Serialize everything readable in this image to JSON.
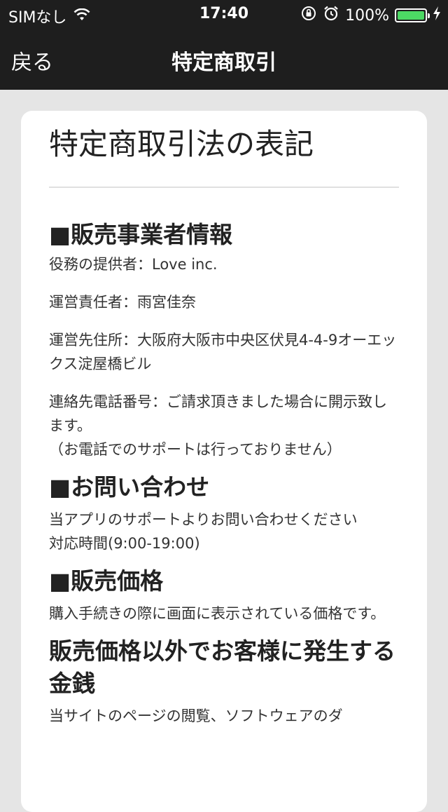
{
  "status_bar": {
    "carrier": "SIMなし",
    "time": "17:40",
    "battery_percent": "100%",
    "icons": [
      "wifi-icon",
      "orientation-lock-icon",
      "alarm-icon",
      "battery-icon",
      "charging-icon"
    ]
  },
  "nav": {
    "back_label": "戻る",
    "title": "特定商取引"
  },
  "page": {
    "title": "特定商取引法の表記",
    "sections": [
      {
        "heading": "■販売事業者情報",
        "paragraphs": [
          "役務の提供者：Love inc.",
          "運営責任者：雨宮佳奈",
          "運営先住所：大阪府大阪市中央区伏見4-4-9オーエックス淀屋橋ビル",
          "連絡先電話番号：ご請求頂きました場合に開示致します。",
          "（お電話でのサポートは行っておりません）"
        ]
      },
      {
        "heading": "■お問い合わせ",
        "paragraphs": [
          "当アプリのサポートよりお問い合わせください",
          "対応時間(9:00-19:00)"
        ]
      },
      {
        "heading": "■販売価格",
        "paragraphs": [
          "購入手続きの際に画面に表示されている価格です。"
        ]
      },
      {
        "heading": "販売価格以外でお客様に発生する金銭",
        "paragraphs": [
          "当サイトのページの閲覧、ソフトウェアのダ"
        ]
      }
    ]
  },
  "colors": {
    "bar_bg": "#1e1e1e",
    "page_bg": "#e5e5e5",
    "card_bg": "#ffffff",
    "battery": "#4cd964"
  }
}
